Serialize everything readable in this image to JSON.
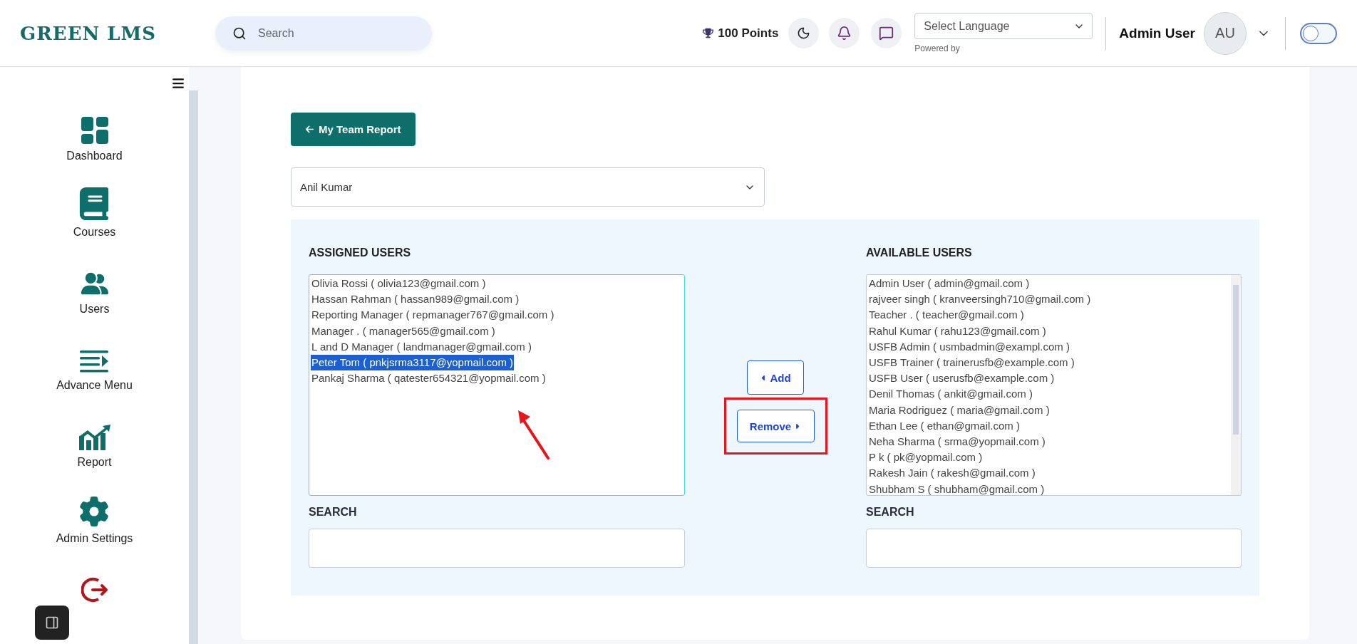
{
  "header": {
    "logo": "GREEN LMS",
    "search": {
      "placeholder": "Search"
    },
    "points": "100 Points",
    "language_select": {
      "value": "Select Language",
      "note": "Powered by"
    },
    "user": {
      "name": "Admin User",
      "initials": "AU"
    },
    "theme_toggle": {
      "on": false
    }
  },
  "sidebar": {
    "items": [
      {
        "kind": "dashboard",
        "label": "Dashboard"
      },
      {
        "kind": "courses",
        "label": "Courses"
      },
      {
        "kind": "users",
        "label": "Users"
      },
      {
        "kind": "advance",
        "label": "Advance Menu"
      },
      {
        "kind": "report",
        "label": "Report"
      },
      {
        "kind": "settings",
        "label": "Admin Settings"
      },
      {
        "kind": "logout"
      }
    ]
  },
  "main": {
    "back_button": "My Team Report",
    "member_select": {
      "value": "Anil Kumar"
    },
    "assigned": {
      "title": "ASSIGNED USERS",
      "items": [
        {
          "label": "Olivia Rossi ( olivia123@gmail.com )",
          "selected": false
        },
        {
          "label": "Hassan Rahman ( hassan989@gmail.com )",
          "selected": false
        },
        {
          "label": "Reporting Manager ( repmanager767@gmail.com )",
          "selected": false
        },
        {
          "label": "Manager . ( manager565@gmail.com )",
          "selected": false
        },
        {
          "label": "L and D Manager ( landmanager@gmail.com )",
          "selected": false
        },
        {
          "label": "Peter Tom ( pnkjsrma3117@yopmail.com )",
          "selected": true
        },
        {
          "label": "Pankaj Sharma ( qatester654321@yopmail.com )",
          "selected": false
        }
      ],
      "search_label": "SEARCH"
    },
    "add_button": "Add",
    "remove_button": "Remove",
    "available": {
      "title": "AVAILABLE USERS",
      "items": [
        {
          "label": "Admin User ( admin@gmail.com )",
          "selected": false
        },
        {
          "label": "rajveer singh ( kranveersingh710@gmail.com )",
          "selected": false
        },
        {
          "label": "Teacher . ( teacher@gmail.com )",
          "selected": false
        },
        {
          "label": "Rahul Kumar ( rahu123@gmail.com )",
          "selected": false
        },
        {
          "label": "USFB Admin ( usmbadmin@exampl.com )",
          "selected": false
        },
        {
          "label": "USFB Trainer ( trainerusfb@example.com )",
          "selected": false
        },
        {
          "label": "USFB User ( userusfb@example.com )",
          "selected": false
        },
        {
          "label": "Denil Thomas ( ankit@gmail.com )",
          "selected": false
        },
        {
          "label": "Maria Rodriguez ( maria@gmail.com )",
          "selected": false
        },
        {
          "label": "Ethan Lee ( ethan@gmail.com )",
          "selected": false
        },
        {
          "label": "Neha Sharma ( srma@yopmail.com )",
          "selected": false
        },
        {
          "label": "P k ( pk@yopmail.com )",
          "selected": false
        },
        {
          "label": "Rakesh Jain ( rakesh@gmail.com )",
          "selected": false
        },
        {
          "label": "Shubham S ( shubham@gmail.com )",
          "selected": false
        }
      ],
      "search_label": "SEARCH"
    }
  }
}
